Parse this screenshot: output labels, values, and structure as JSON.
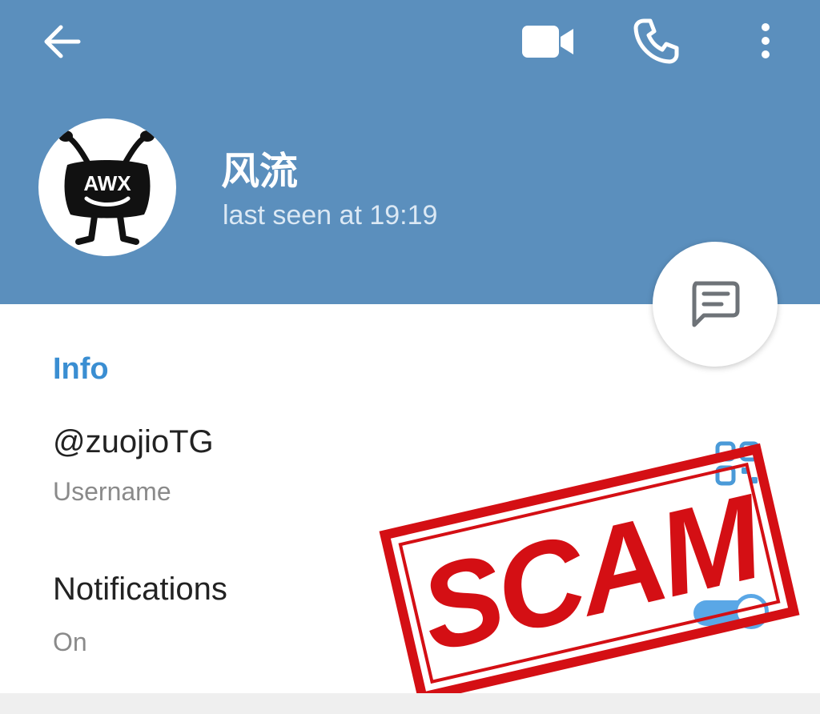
{
  "colors": {
    "header": "#5b8fbd",
    "accent": "#3a8ed2",
    "toggle": "#5aa7e6",
    "stamp": "#d40f14"
  },
  "toolbar": {
    "back_icon": "arrow-left-icon",
    "video_icon": "video-camera-icon",
    "call_icon": "phone-icon",
    "menu_icon": "more-vertical-icon"
  },
  "profile": {
    "name": "风流",
    "status": "last seen at 19:19",
    "avatar_text": "AWX"
  },
  "fab": {
    "icon": "message-icon"
  },
  "info": {
    "title": "Info",
    "username_value": "@zuojioTG",
    "username_label": "Username",
    "qr_icon": "qr-code-icon",
    "notifications_label": "Notifications",
    "notifications_value": "On",
    "notifications_enabled": true
  },
  "overlay": {
    "stamp_text": "SCAM"
  }
}
